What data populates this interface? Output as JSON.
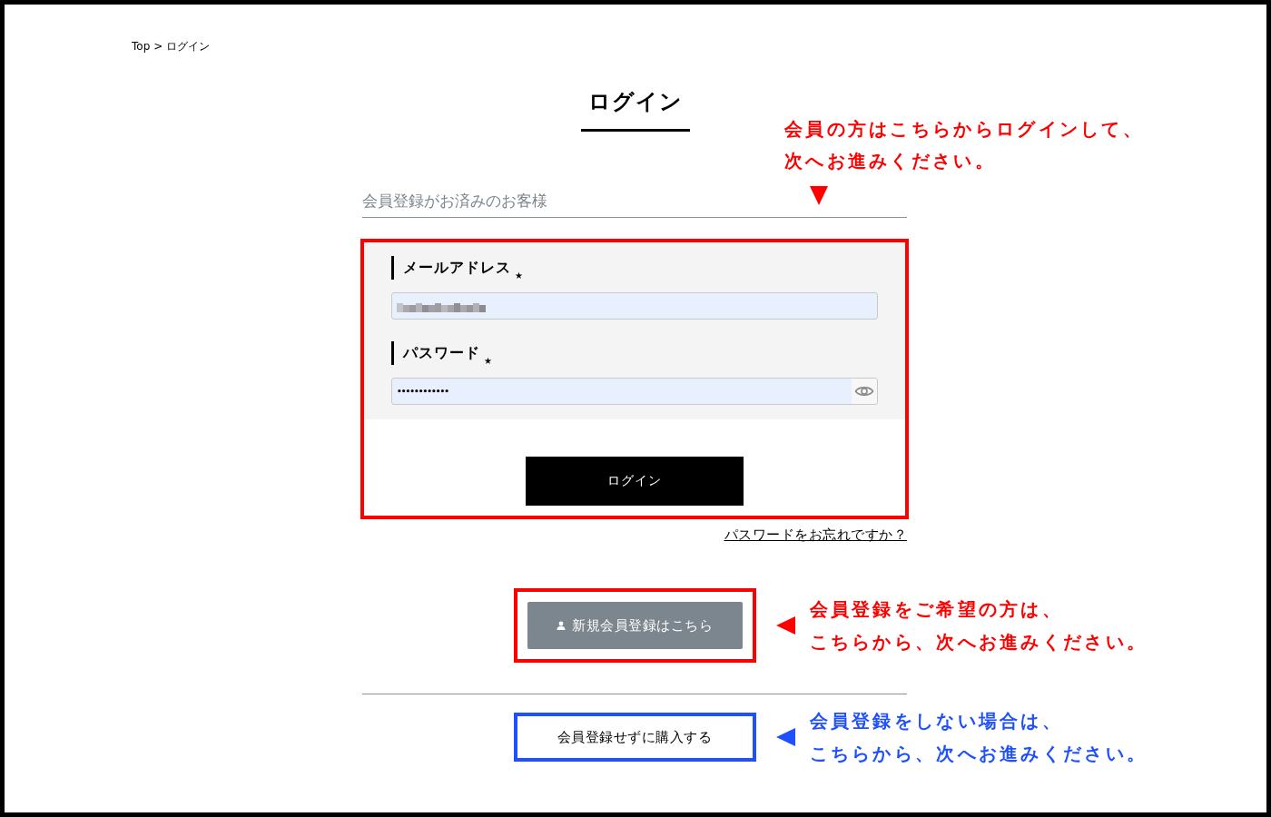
{
  "breadcrumb": {
    "items": [
      {
        "label": "Top"
      },
      {
        "label": "ログイン"
      }
    ],
    "separator": ">"
  },
  "page_title": "ログイン",
  "member_section": {
    "heading": "会員登録がお済みのお客様",
    "annotation": {
      "kind": "pointer-down",
      "lines": [
        "会員の方はこちらからログインして、",
        "次へお進みください。"
      ],
      "color": "#ff0000"
    },
    "fields": [
      {
        "kind": "email",
        "label": "メールアドレス",
        "required_mark": "★",
        "value_blurred": true
      },
      {
        "kind": "password",
        "label": "パスワード",
        "required_mark": "★",
        "value": "••••••••••••"
      }
    ],
    "login_button": "ログイン",
    "forgot_link": "パスワードをお忘れですか？"
  },
  "register_button": {
    "label": "新規会員登録はこちら",
    "annotation": {
      "kind": "pointer-left",
      "lines": [
        "会員登録をご希望の方は、",
        "こちらから、次へお進みください。"
      ],
      "color": "#ff0000"
    }
  },
  "guest_button": {
    "label": "会員登録せずに購入する",
    "annotation": {
      "kind": "pointer-left",
      "lines": [
        "会員登録をしない場合は、",
        "こちらから、次へお進みください。"
      ],
      "color": "#1e50ff"
    }
  }
}
